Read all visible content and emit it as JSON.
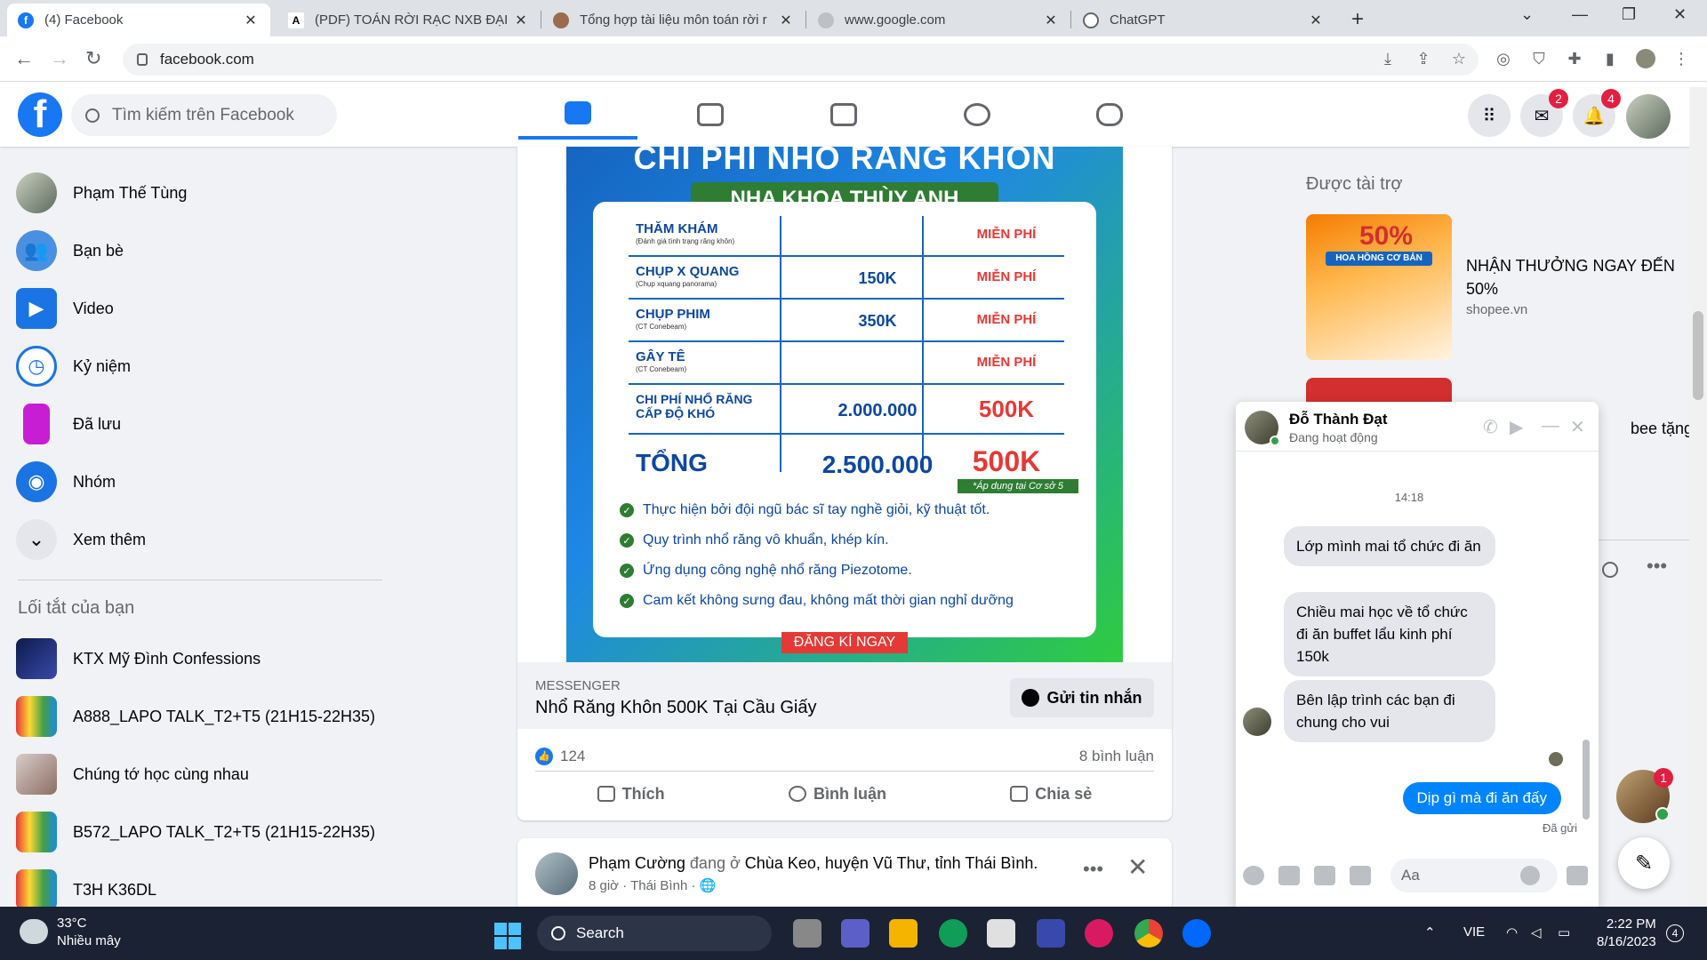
{
  "browser": {
    "tabs": [
      {
        "title": "(4) Facebook",
        "active": true
      },
      {
        "title": "(PDF) TOÁN RỜI RẠC NXB ĐẠI H",
        "active": false
      },
      {
        "title": "Tổng hợp tài liệu môn toán rời r",
        "active": false
      },
      {
        "title": "www.google.com",
        "active": false
      },
      {
        "title": "ChatGPT",
        "active": false
      }
    ],
    "url": "facebook.com"
  },
  "header": {
    "search_placeholder": "Tìm kiếm trên Facebook",
    "messenger_badge": "2",
    "notifications_badge": "4"
  },
  "sidebar": {
    "items": [
      {
        "label": "Phạm Thế Tùng",
        "icon": "avatar"
      },
      {
        "label": "Bạn bè",
        "icon": "friends-icon"
      },
      {
        "label": "Video",
        "icon": "video-icon"
      },
      {
        "label": "Kỷ niệm",
        "icon": "memories-icon"
      },
      {
        "label": "Đã lưu",
        "icon": "saved-icon"
      },
      {
        "label": "Nhóm",
        "icon": "groups-icon"
      },
      {
        "label": "Xem thêm",
        "icon": "chevron-down-icon"
      }
    ],
    "shortcuts_title": "Lối tắt của bạn",
    "shortcuts": [
      {
        "label": "KTX Mỹ Đình Confessions"
      },
      {
        "label": "A888_LAPO TALK_T2+T5 (21H15-22H35)"
      },
      {
        "label": "Chúng tớ học cùng nhau"
      },
      {
        "label": "B572_LAPO TALK_T2+T5 (21H15-22H35)"
      },
      {
        "label": "T3H K36DL"
      }
    ]
  },
  "ad": {
    "heading": "CHI PHÍ NHỔ RĂNG KHÔN",
    "clinic": "NHA KHOA THÙY ANH",
    "rows": [
      {
        "name": "THĂM KHÁM",
        "note": "(Đánh giá tình trạng răng khôn)",
        "price": "",
        "free": "MIỄN PHÍ"
      },
      {
        "name": "CHỤP X QUANG",
        "note": "(Chụp xquang panorama)",
        "price": "150K",
        "free": "MIỄN PHÍ"
      },
      {
        "name": "CHỤP PHIM",
        "note": "(CT Conebeam)",
        "price": "350K",
        "free": "MIỄN PHÍ"
      },
      {
        "name": "GÂY TÊ",
        "note": "(CT Conebeam)",
        "price": "",
        "free": "MIỄN PHÍ"
      },
      {
        "name": "CHI PHÍ NHỔ RĂNG CẤP ĐỘ KHÓ",
        "note": "",
        "price": "2.000.000",
        "free": "500K"
      },
      {
        "name": "TỔNG",
        "note": "",
        "price": "2.500.000",
        "free": "500K"
      }
    ],
    "condition": "*Áp dụng tại Cơ sở 5",
    "checks": [
      "Thực hiện bởi đội ngũ bác sĩ tay nghề giỏi, kỹ thuật tốt.",
      "Quy trình nhổ răng vô khuẩn, khép kín.",
      "Ứng dụng công nghệ nhổ răng Piezotome.",
      "Cam kết không sưng đau, không mất thời gian nghỉ dưỡng"
    ],
    "cta": "ĐĂNG KÍ NGAY",
    "source": "MESSENGER",
    "headline": "Nhổ Răng Khôn 500K Tại Cầu Giấy",
    "send_button": "Gửi tin nhắn",
    "likes": "124",
    "comments": "8 bình luận",
    "like_label": "Thích",
    "comment_label": "Bình luận",
    "share_label": "Chia sẻ"
  },
  "post2": {
    "author": "Phạm Cường",
    "verb": "đang ở",
    "place": "Chùa Keo, huyện Vũ Thư, tỉnh Thái Bình.",
    "meta": "8 giờ · Thái Bình ·"
  },
  "sponsored": {
    "title": "Được tài trợ",
    "promo": "50%",
    "promo_sub": "HOA HỒNG CƠ BẢN",
    "ad1_text": "NHẬN THƯỞNG NGAY ĐẾN 50%",
    "ad1_url": "shopee.vn",
    "ad2_text": "bee tặng"
  },
  "chat": {
    "name": "Đỗ Thành Đạt",
    "status": "Đang hoạt động",
    "time": "14:18",
    "messages": [
      "Lớp mình mai tổ chức đi ăn",
      "Chiều mai học về tổ chức đi ăn buffet lẩu kinh phí 150k",
      "Bên lập trình các bạn đi chung cho vui"
    ],
    "my_message": "Dịp gì mà đi ăn đấy",
    "seen": "Đã gửi",
    "input_placeholder": "Aa",
    "floating_badge": "1"
  },
  "taskbar": {
    "temp": "33°C",
    "weather": "Nhiều mây",
    "search": "Search",
    "lang": "VIE",
    "time": "2:22 PM",
    "date": "8/16/2023",
    "notifications": "4"
  },
  "colors": {
    "fb_blue": "#1877f2",
    "messenger_blue": "#0084ff",
    "badge_red": "#e41e3f"
  }
}
